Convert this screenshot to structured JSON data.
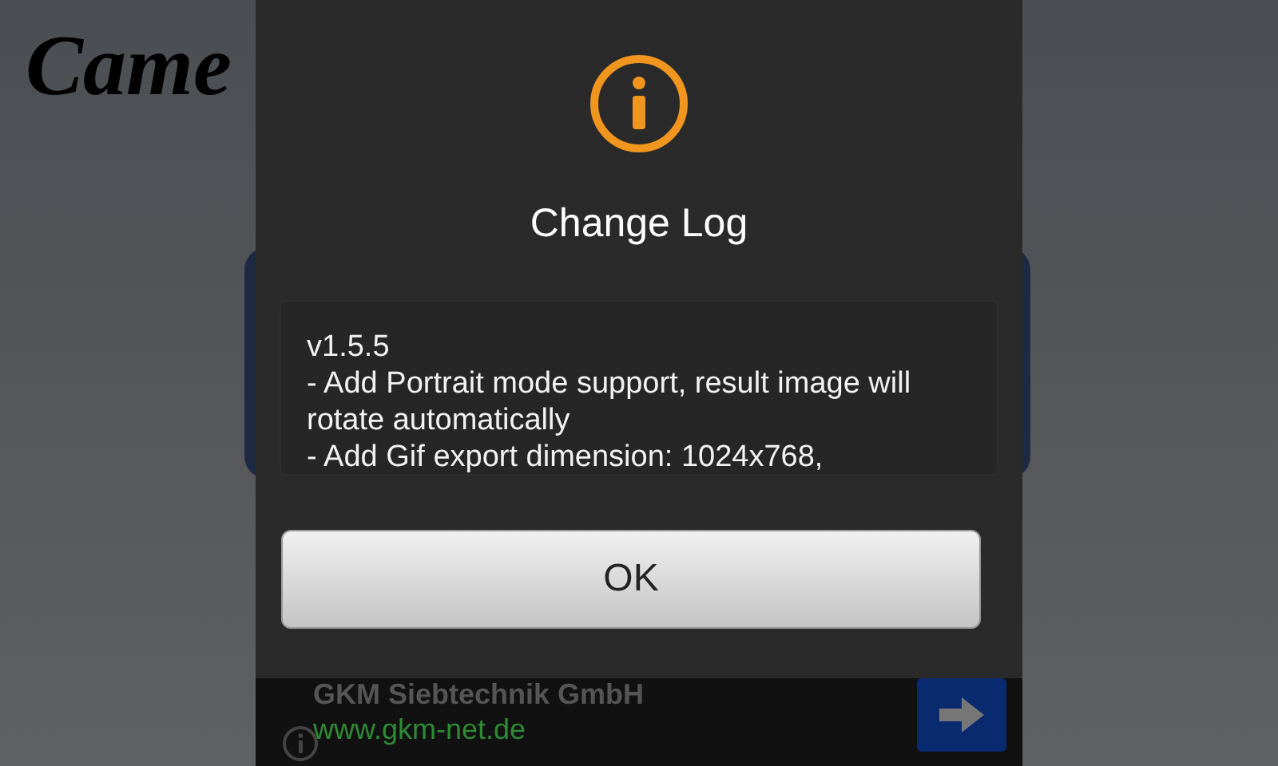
{
  "page": {
    "heading": "Came"
  },
  "dialog": {
    "title": "Change Log",
    "lines": [
      "v1.5.5",
      "- Add Portrait mode support, result image will rotate automatically",
      "- Add Gif export dimension: 1024x768,"
    ],
    "buttons": [
      "OK"
    ]
  },
  "ad": {
    "title": "GKM Siebtechnik GmbH",
    "url": "www.gkm-net.de"
  }
}
